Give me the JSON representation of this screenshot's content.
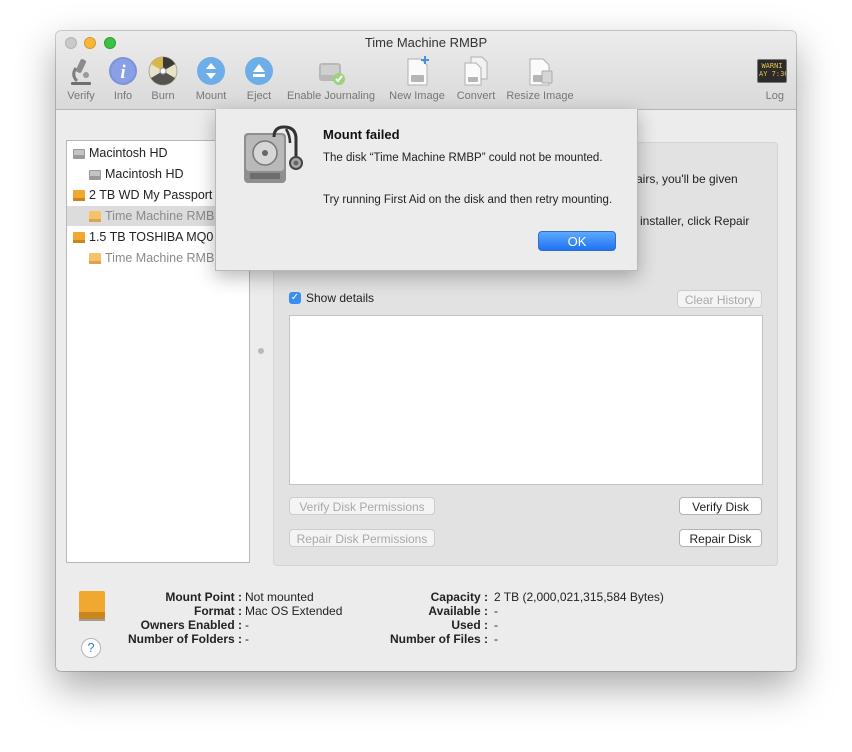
{
  "window": {
    "title": "Time Machine RMBP"
  },
  "toolbar": {
    "items": [
      {
        "label": "Verify",
        "icon": "microscope-icon"
      },
      {
        "label": "Info",
        "icon": "info-icon"
      },
      {
        "label": "Burn",
        "icon": "burn-icon"
      },
      {
        "label": "Mount",
        "icon": "mount-icon"
      },
      {
        "label": "Eject",
        "icon": "eject-icon"
      },
      {
        "label": "Enable Journaling",
        "icon": "journaling-icon"
      },
      {
        "label": "New Image",
        "icon": "new-image-icon"
      },
      {
        "label": "Convert",
        "icon": "convert-icon"
      },
      {
        "label": "Resize Image",
        "icon": "resize-image-icon"
      }
    ],
    "log_label": "Log",
    "log_icon_text_line1": "WARNI",
    "log_icon_text_line2": "AY 7:36"
  },
  "sidebar": {
    "items": [
      {
        "label": "Macintosh HD"
      },
      {
        "label": "Macintosh HD"
      },
      {
        "label": "2 TB WD My Passport"
      },
      {
        "label": "Time Machine RMBP"
      },
      {
        "label": "1.5 TB TOSHIBA MQ0"
      },
      {
        "label": "Time Machine RMBP"
      }
    ]
  },
  "panel": {
    "partial_line1": "airs, you'll be given",
    "partial_line2": "installer, click Repair",
    "show_details_label": "Show details",
    "clear_history_label": "Clear History",
    "verify_permissions_label": "Verify Disk Permissions",
    "repair_permissions_label": "Repair Disk Permissions",
    "verify_disk_label": "Verify Disk",
    "repair_disk_label": "Repair Disk"
  },
  "info": {
    "left": [
      {
        "key": "Mount Point :",
        "value": "Not mounted"
      },
      {
        "key": "Format :",
        "value": "Mac OS Extended"
      },
      {
        "key": "Owners Enabled :",
        "value": "-"
      },
      {
        "key": "Number of Folders :",
        "value": "-"
      }
    ],
    "right": [
      {
        "key": "Capacity :",
        "value": "2 TB (2,000,021,315,584 Bytes)"
      },
      {
        "key": "Available :",
        "value": "-"
      },
      {
        "key": "Used :",
        "value": "-"
      },
      {
        "key": "Number of Files :",
        "value": "-"
      }
    ],
    "help_label": "?"
  },
  "alert": {
    "title": "Mount failed",
    "message": "The disk “Time Machine RMBP” could not be mounted.",
    "detail": "Try running First Aid on the disk and then retry mounting.",
    "ok_label": "OK"
  },
  "colors": {
    "accent": "#3b8ff0",
    "drive_orange": "#f0a830"
  }
}
